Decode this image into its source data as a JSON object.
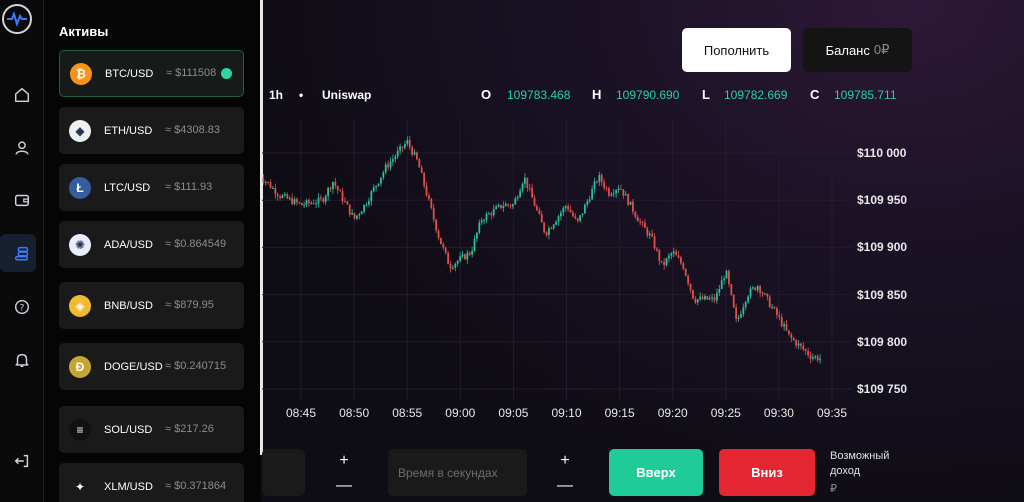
{
  "colors": {
    "accent_green": "#1fcc97",
    "accent_red": "#e3262f",
    "up_candle": "#2bbf9a",
    "down_candle": "#e0504a"
  },
  "sidebar": {
    "items": [
      {
        "name": "home",
        "icon": "home-icon"
      },
      {
        "name": "profile",
        "icon": "user-icon"
      },
      {
        "name": "wallet",
        "icon": "wallet-icon"
      },
      {
        "name": "assets",
        "icon": "coins-icon",
        "active": true
      },
      {
        "name": "help",
        "icon": "help-icon"
      },
      {
        "name": "notifications",
        "icon": "bell-icon"
      },
      {
        "name": "logout",
        "icon": "logout-icon"
      }
    ]
  },
  "assets_panel": {
    "title": "Активы",
    "items": [
      {
        "symbol": "BTC/USD",
        "price": "≈ $111508",
        "icon": "bitcoin-icon",
        "color": "#f7931a",
        "glyph": "₿",
        "active": true
      },
      {
        "symbol": "ETH/USD",
        "price": "≈ $4308.83",
        "icon": "ethereum-icon",
        "color": "#ecf0f1",
        "glyph": "◆"
      },
      {
        "symbol": "LTC/USD",
        "price": "≈ $111.93",
        "icon": "litecoin-icon",
        "color": "#345d9d",
        "glyph": "Ł"
      },
      {
        "symbol": "ADA/USD",
        "price": "≈ $0.864549",
        "icon": "cardano-icon",
        "color": "#e8eefc",
        "glyph": "✺"
      },
      {
        "symbol": "BNB/USD",
        "price": "≈ $879.95",
        "icon": "bnb-icon",
        "color": "#f3ba2f",
        "glyph": "◈"
      },
      {
        "symbol": "DOGE/USD",
        "price": "≈ $0.240715",
        "icon": "dogecoin-icon",
        "color": "#c3a634",
        "glyph": "Ð"
      },
      {
        "symbol": "SOL/USD",
        "price": "≈ $217.26",
        "icon": "solana-icon",
        "color": "#111111",
        "glyph": "≡"
      },
      {
        "symbol": "XLM/USD",
        "price": "≈ $0.371864",
        "icon": "stellar-icon",
        "color": "#1a1a1a",
        "glyph": "✦"
      }
    ]
  },
  "header": {
    "deposit_label": "Пополнить",
    "balance_label": "Баланс",
    "balance_value": "0₽"
  },
  "chart_toolbar": {
    "timeframe": "1h",
    "separator": "•",
    "source": "Uniswap",
    "ohlc": {
      "o_label": "O",
      "o_value": "109783.468",
      "h_label": "H",
      "h_value": "109790.690",
      "l_label": "L",
      "l_value": "109782.669",
      "c_label": "C",
      "c_value": "109785.711"
    }
  },
  "chart_data": {
    "type": "candlestick",
    "title": "",
    "y_ticks": [
      "$110 000",
      "$109 950",
      "$109 900",
      "$109 850",
      "$109 800",
      "$109 750"
    ],
    "x_ticks": [
      "08:45",
      "08:50",
      "08:55",
      "09:00",
      "09:05",
      "09:10",
      "09:15",
      "09:20",
      "09:25",
      "09:30",
      "09:35"
    ],
    "ylim": [
      109740,
      110030
    ],
    "trend_points": [
      {
        "x": "08:41",
        "y": 109978
      },
      {
        "x": "08:43",
        "y": 109955
      },
      {
        "x": "08:45",
        "y": 109945
      },
      {
        "x": "08:47",
        "y": 109950
      },
      {
        "x": "08:48",
        "y": 109970
      },
      {
        "x": "08:50",
        "y": 109930
      },
      {
        "x": "08:51",
        "y": 109945
      },
      {
        "x": "08:53",
        "y": 109985
      },
      {
        "x": "08:55",
        "y": 110012
      },
      {
        "x": "08:56",
        "y": 109990
      },
      {
        "x": "08:58",
        "y": 109910
      },
      {
        "x": "08:59",
        "y": 109880
      },
      {
        "x": "09:01",
        "y": 109895
      },
      {
        "x": "09:02",
        "y": 109930
      },
      {
        "x": "09:04",
        "y": 109945
      },
      {
        "x": "09:05",
        "y": 109945
      },
      {
        "x": "09:06",
        "y": 109975
      },
      {
        "x": "09:08",
        "y": 109915
      },
      {
        "x": "09:09",
        "y": 109930
      },
      {
        "x": "09:10",
        "y": 109945
      },
      {
        "x": "09:11",
        "y": 109925
      },
      {
        "x": "09:13",
        "y": 109975
      },
      {
        "x": "09:14",
        "y": 109958
      },
      {
        "x": "09:15",
        "y": 109965
      },
      {
        "x": "09:17",
        "y": 109925
      },
      {
        "x": "09:18",
        "y": 109910
      },
      {
        "x": "09:19",
        "y": 109880
      },
      {
        "x": "09:20",
        "y": 109895
      },
      {
        "x": "09:21",
        "y": 109880
      },
      {
        "x": "09:22",
        "y": 109845
      },
      {
        "x": "09:24",
        "y": 109845
      },
      {
        "x": "09:25",
        "y": 109875
      },
      {
        "x": "09:26",
        "y": 109820
      },
      {
        "x": "09:27",
        "y": 109850
      },
      {
        "x": "09:28",
        "y": 109860
      },
      {
        "x": "09:30",
        "y": 109825
      },
      {
        "x": "09:31",
        "y": 109805
      },
      {
        "x": "09:33",
        "y": 109785
      },
      {
        "x": "09:34",
        "y": 109782
      }
    ]
  },
  "trade_controls": {
    "amount_plus": "+",
    "amount_minus": "—",
    "time_placeholder": "Время в секундах",
    "time_plus": "+",
    "time_minus": "—",
    "up_label": "Вверх",
    "down_label": "Вниз",
    "income_label": "Возможный доход",
    "income_value": "₽"
  }
}
